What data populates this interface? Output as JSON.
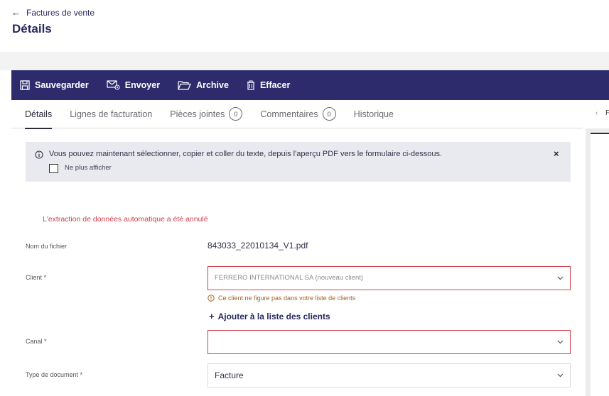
{
  "header": {
    "back_label": "Factures de vente",
    "title": "Détails"
  },
  "toolbar": {
    "save_label": "Sauvegarder",
    "send_label": "Envoyer",
    "archive_label": "Archive",
    "delete_label": "Effacer"
  },
  "tabs": [
    {
      "label": "Détails"
    },
    {
      "label": "Lignes de facturation"
    },
    {
      "label": "Pièces jointes",
      "count": "0"
    },
    {
      "label": "Commentaires",
      "count": "0"
    },
    {
      "label": "Historique"
    }
  ],
  "side": {
    "collapse_icon": "chevron-left-icon",
    "letter": "F"
  },
  "info_banner": {
    "text": "Vous pouvez maintenant sélectionner, copier et coller du texte, depuis l'aperçu PDF vers le formulaire ci-dessous.",
    "checkbox_label": "Ne plus afficher",
    "close_glyph": "×"
  },
  "form": {
    "error_message": "L'extraction de données automatique a été annulé",
    "filename": {
      "label": "Nom du fichier",
      "value": "843033_22010134_V1.pdf"
    },
    "client": {
      "label": "Client *",
      "value": "FERRERO INTERNATIONAL SA (nouveau client)",
      "warning": "Ce client ne figure pas dans votre liste de clients",
      "add_label": "Ajouter à la liste des clients"
    },
    "canal": {
      "label": "Canal *",
      "value": ""
    },
    "doc_type": {
      "label": "Type de document *",
      "value": "Facture"
    }
  },
  "colors": {
    "toolbar_bg": "#2d2b6b",
    "title": "#2a2960",
    "error": "#d0404a",
    "warning": "#9a6520",
    "banner_bg": "#e9e9f0"
  }
}
